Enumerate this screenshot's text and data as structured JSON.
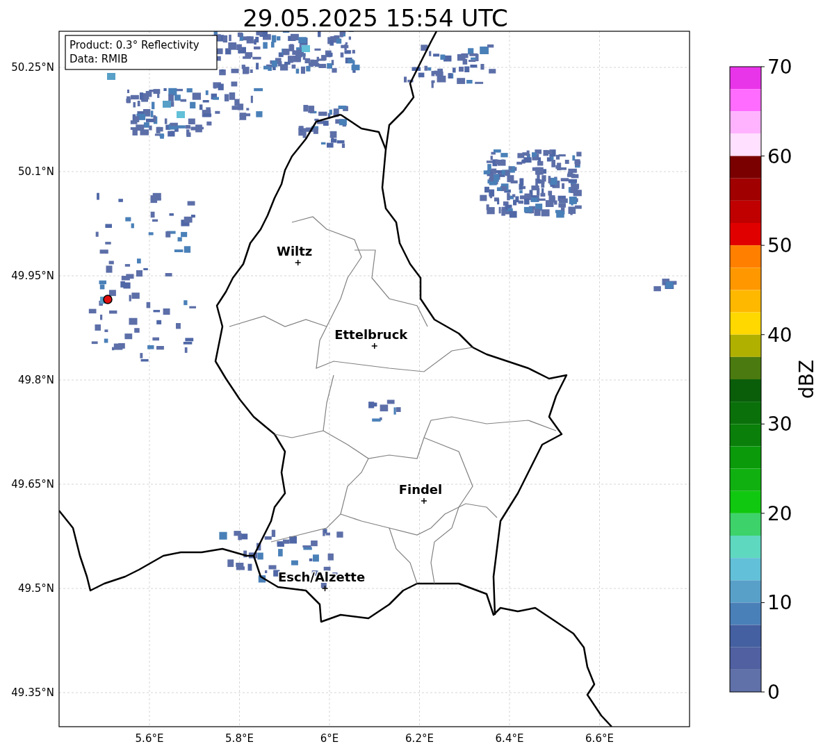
{
  "title": "29.05.2025 15:54 UTC",
  "info": [
    "Product: 0.3° Reflectivity",
    "Data: RMIB"
  ],
  "y_ticks": [
    "50.25°N",
    "50.1°N",
    "49.95°N",
    "49.8°N",
    "49.65°N",
    "49.5°N",
    "49.35°N"
  ],
  "x_ticks": [
    "5.6°E",
    "5.8°E",
    "6°E",
    "6.2°E",
    "6.4°E",
    "6.6°E"
  ],
  "cities": [
    {
      "name": "Wiltz"
    },
    {
      "name": "Ettelbruck"
    },
    {
      "name": "Findel"
    },
    {
      "name": "Esch/Alzette"
    }
  ],
  "colorbar": {
    "label": "dBZ",
    "ticks": [
      "70",
      "60",
      "50",
      "40",
      "30",
      "20",
      "10",
      "0"
    ],
    "bins": [
      {
        "color": "#e935e9"
      },
      {
        "color": "#ff6cff"
      },
      {
        "color": "#ffb3ff"
      },
      {
        "color": "#ffe0ff"
      },
      {
        "color": "#7a0000"
      },
      {
        "color": "#a00000"
      },
      {
        "color": "#c00000"
      },
      {
        "color": "#e00000"
      },
      {
        "color": "#ff7f00"
      },
      {
        "color": "#ff9800"
      },
      {
        "color": "#ffb800"
      },
      {
        "color": "#ffd800"
      },
      {
        "color": "#b0b000"
      },
      {
        "color": "#4a7a10"
      },
      {
        "color": "#0a5e0a"
      },
      {
        "color": "#0a700a"
      },
      {
        "color": "#0a800a"
      },
      {
        "color": "#0a9a0a"
      },
      {
        "color": "#10b010"
      },
      {
        "color": "#10c810"
      },
      {
        "color": "#3dd36a"
      },
      {
        "color": "#5fd8c0"
      },
      {
        "color": "#62c0d8"
      },
      {
        "color": "#58a0c8"
      },
      {
        "color": "#4a80b8"
      },
      {
        "color": "#4460a0"
      },
      {
        "color": "#5060a0"
      },
      {
        "color": "#6070a8"
      }
    ]
  }
}
